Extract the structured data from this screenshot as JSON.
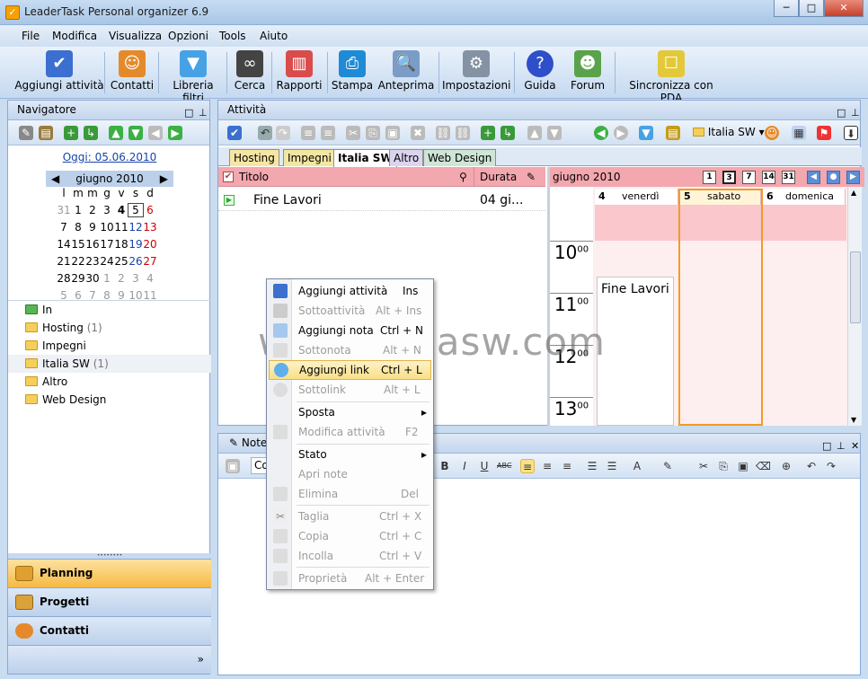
{
  "window": {
    "title": "LeaderTask Personal organizer 6.9"
  },
  "menu": [
    "File",
    "Modifica",
    "Visualizza",
    "Opzioni",
    "Tools",
    "Aiuto"
  ],
  "toolbar": [
    {
      "label": "Aggiungi attività",
      "icon": "add-task-icon"
    },
    {
      "label": "Contatti",
      "icon": "contacts-icon"
    },
    {
      "label": "Libreria filtri",
      "icon": "filter-icon"
    },
    {
      "label": "Cerca",
      "icon": "binoculars-icon"
    },
    {
      "label": "Rapporti",
      "icon": "reports-icon"
    },
    {
      "label": "Stampa",
      "icon": "printer-icon"
    },
    {
      "label": "Anteprima",
      "icon": "preview-icon"
    },
    {
      "label": "Impostazioni",
      "icon": "gear-icon"
    },
    {
      "label": "Guida",
      "icon": "help-icon"
    },
    {
      "label": "Forum",
      "icon": "forum-icon"
    },
    {
      "label": "Sincronizza con PDA",
      "icon": "pda-sync-icon"
    }
  ],
  "navigator": {
    "title": "Navigatore",
    "today": "Oggi: 05.06.2010",
    "month": "giugno 2010",
    "weekdays": [
      "l",
      "m",
      "m",
      "g",
      "v",
      "s",
      "d"
    ],
    "weeks": [
      [
        "31",
        "1",
        "2",
        "3",
        "4",
        "5",
        "6"
      ],
      [
        "7",
        "8",
        "9",
        "10",
        "11",
        "12",
        "13"
      ],
      [
        "14",
        "15",
        "16",
        "17",
        "18",
        "19",
        "20"
      ],
      [
        "21",
        "22",
        "23",
        "24",
        "25",
        "26",
        "27"
      ],
      [
        "28",
        "29",
        "30",
        "1",
        "2",
        "3",
        "4"
      ],
      [
        "5",
        "6",
        "7",
        "8",
        "9",
        "10",
        "11"
      ]
    ],
    "folders": [
      {
        "name": "In",
        "count": ""
      },
      {
        "name": "Hosting",
        "count": "(1)"
      },
      {
        "name": "Impegni",
        "count": ""
      },
      {
        "name": "Italia SW",
        "count": "(1)"
      },
      {
        "name": "Altro",
        "count": ""
      },
      {
        "name": "Web Design",
        "count": ""
      }
    ],
    "sections": [
      "Planning",
      "Progetti",
      "Contatti"
    ]
  },
  "activity": {
    "title": "Attività",
    "filter_label": "Italia SW",
    "tabs": [
      "Hosting",
      "Impegni",
      "Italia SW",
      "Altro",
      "Web Design"
    ],
    "columns": {
      "title": "Titolo",
      "duration": "Durata"
    },
    "rows": [
      {
        "title": "Fine Lavori",
        "duration": "04 gi..."
      }
    ],
    "calendar": {
      "month": "giugno 2010",
      "view_buttons": [
        "1",
        "3",
        "7",
        "14",
        "31"
      ],
      "days": [
        {
          "num": "4",
          "name": "venerdì"
        },
        {
          "num": "5",
          "name": "sabato"
        },
        {
          "num": "6",
          "name": "domenica"
        }
      ],
      "hours": [
        "10",
        "11",
        "12",
        "13"
      ],
      "minutes": "00",
      "event": "Fine Lavori"
    }
  },
  "notes": {
    "title": "Note",
    "font_field": "Co"
  },
  "watermark": "www.italiasw.com",
  "context_menu": [
    {
      "label": "Aggiungi attività",
      "shortcut": "Ins",
      "disabled": false
    },
    {
      "label": "Sottoattività",
      "shortcut": "Alt + Ins",
      "disabled": true
    },
    {
      "label": "Aggiungi nota",
      "shortcut": "Ctrl + N",
      "disabled": false
    },
    {
      "label": "Sottonota",
      "shortcut": "Alt + N",
      "disabled": true
    },
    {
      "label": "Aggiungi link",
      "shortcut": "Ctrl + L",
      "disabled": false,
      "highlighted": true
    },
    {
      "label": "Sottolink",
      "shortcut": "Alt + L",
      "disabled": true
    },
    {
      "label": "Sposta",
      "shortcut": "",
      "disabled": false,
      "submenu": true
    },
    {
      "label": "Modifica attività",
      "shortcut": "F2",
      "disabled": true
    },
    {
      "label": "Stato",
      "shortcut": "",
      "disabled": false,
      "submenu": true
    },
    {
      "label": "Apri note",
      "shortcut": "",
      "disabled": true
    },
    {
      "label": "Elimina",
      "shortcut": "Del",
      "disabled": true
    },
    {
      "label": "Taglia",
      "shortcut": "Ctrl + X",
      "disabled": true
    },
    {
      "label": "Copia",
      "shortcut": "Ctrl + C",
      "disabled": true
    },
    {
      "label": "Incolla",
      "shortcut": "Ctrl + V",
      "disabled": true
    },
    {
      "label": "Proprietà",
      "shortcut": "Alt + Enter",
      "disabled": true
    }
  ]
}
